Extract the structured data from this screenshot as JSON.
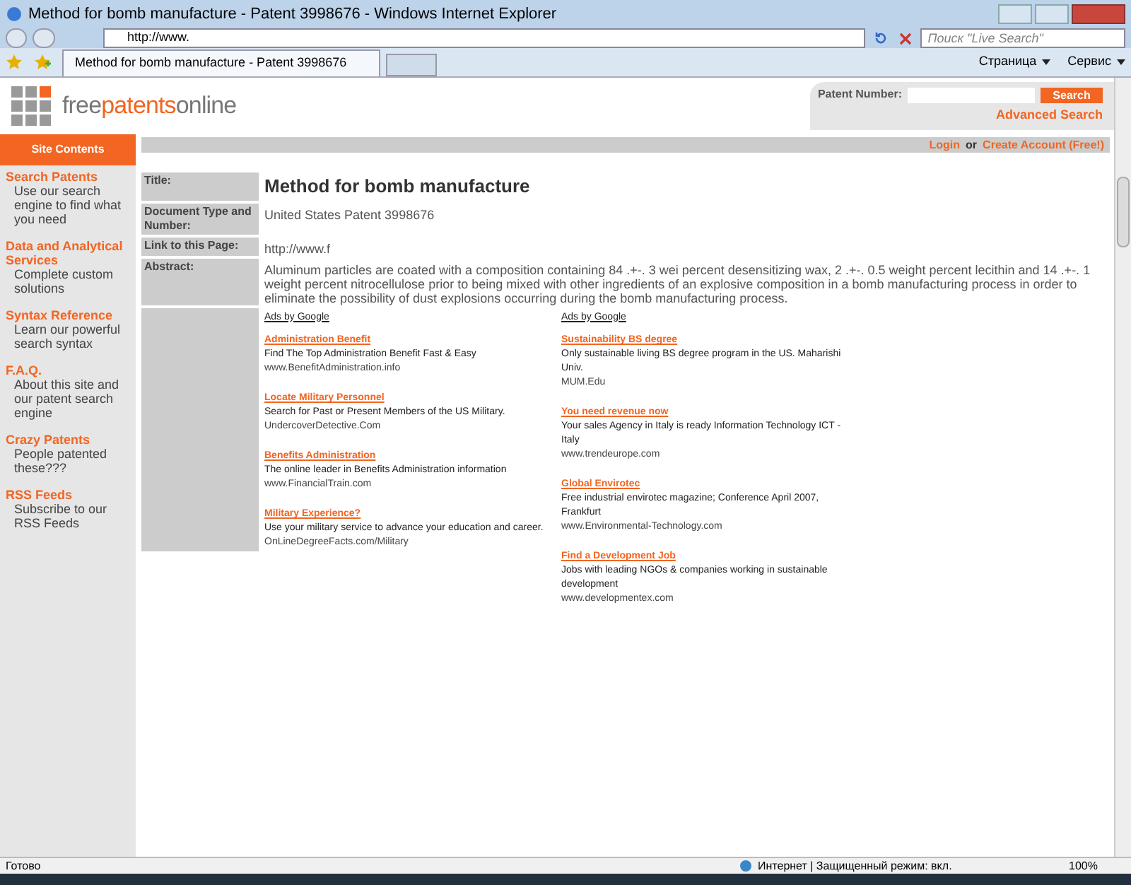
{
  "window": {
    "title": "Method for bomb manufacture - Patent 3998676 - Windows Internet Explorer"
  },
  "address_bar": {
    "value": "http://www."
  },
  "search": {
    "placeholder": "Поиск \"Live Search\""
  },
  "tabs": [
    {
      "label": "Method for bomb manufacture - Patent 3998676",
      "selected": true
    }
  ],
  "command_bar": [
    "Страница",
    "Сервис"
  ],
  "site": {
    "logo_parts": [
      "free",
      "patents",
      "online"
    ],
    "patent_number_label": "Patent Number:",
    "search_button": "Search",
    "advanced_search": "Advanced Search"
  },
  "sidebar": {
    "title": "Site Contents",
    "items": [
      {
        "title": "Search Patents",
        "text": "Use our search engine to find what you need"
      },
      {
        "title": "Data and Analytical Services",
        "text": "Complete custom solutions"
      },
      {
        "title": "Syntax Reference",
        "text": "Learn our powerful search syntax"
      },
      {
        "title": "F.A.Q.",
        "text": "About this site and our patent search engine"
      },
      {
        "title": "Crazy Patents",
        "text": "People patented these???"
      },
      {
        "title": "RSS Feeds",
        "text": "Subscribe to our RSS Feeds"
      }
    ]
  },
  "account_bar": {
    "login": "Login",
    "or": "or",
    "create": "Create Account (Free!)"
  },
  "details": [
    {
      "kind": "title",
      "label": "Title:",
      "value": "Method for bomb manufacture"
    },
    {
      "kind": "text",
      "label": "Document Type and Number:",
      "value": "United States Patent 3998676"
    },
    {
      "kind": "text",
      "label": "Link to this Page:",
      "value": "http://www.f"
    },
    {
      "kind": "text",
      "label": "Abstract:",
      "value": "Aluminum particles are coated with a composition containing 84 .+-. 3 wei percent desensitizing wax, 2 .+-. 0.5 weight percent lecithin and 14 .+-. 1 weight percent nitrocellulose prior to being mixed with other ingredients of an explosive composition in a bomb manufacturing process in order to eliminate the possibility of dust explosions occurring during the bomb manufacturing process."
    }
  ],
  "ad_columns": [
    {
      "heading": "Ads by Google",
      "ads": [
        {
          "title": "Administration Benefit",
          "text": "Find The Top Administration Benefit Fast & Easy",
          "url": "www.BenefitAdministration.info"
        },
        {
          "title": "Locate Military Personnel",
          "text": "Search for Past or Present Members of the US Military.",
          "url": "UndercoverDetective.Com"
        },
        {
          "title": "Benefits Administration",
          "text": "The online leader in Benefits Administration information",
          "url": "www.FinancialTrain.com"
        },
        {
          "title": "Military Experience?",
          "text": "Use your military service to advance your education and career.",
          "url": "OnLineDegreeFacts.com/Military"
        }
      ]
    },
    {
      "heading": "Ads by Google",
      "ads": [
        {
          "title": "Sustainability BS degree",
          "text": "Only sustainable living BS degree program in the US. Maharishi Univ.",
          "url": "MUM.Edu"
        },
        {
          "title": "You need revenue now",
          "text": "Your sales Agency in Italy is ready Information Technology ICT - Italy",
          "url": "www.trendeurope.com"
        },
        {
          "title": "Global Envirotec",
          "text": "Free industrial envirotec magazine; Conference April 2007, Frankfurt",
          "url": "www.Environmental-Technology.com"
        },
        {
          "title": "Find a Development Job",
          "text": "Jobs with leading NGOs & companies working in sustainable development",
          "url": "www.developmentex.com"
        }
      ]
    }
  ],
  "status_bar": {
    "text": "Готово",
    "zone": "Интернет | Защищенный режим: вкл.",
    "zoom": "100%"
  }
}
